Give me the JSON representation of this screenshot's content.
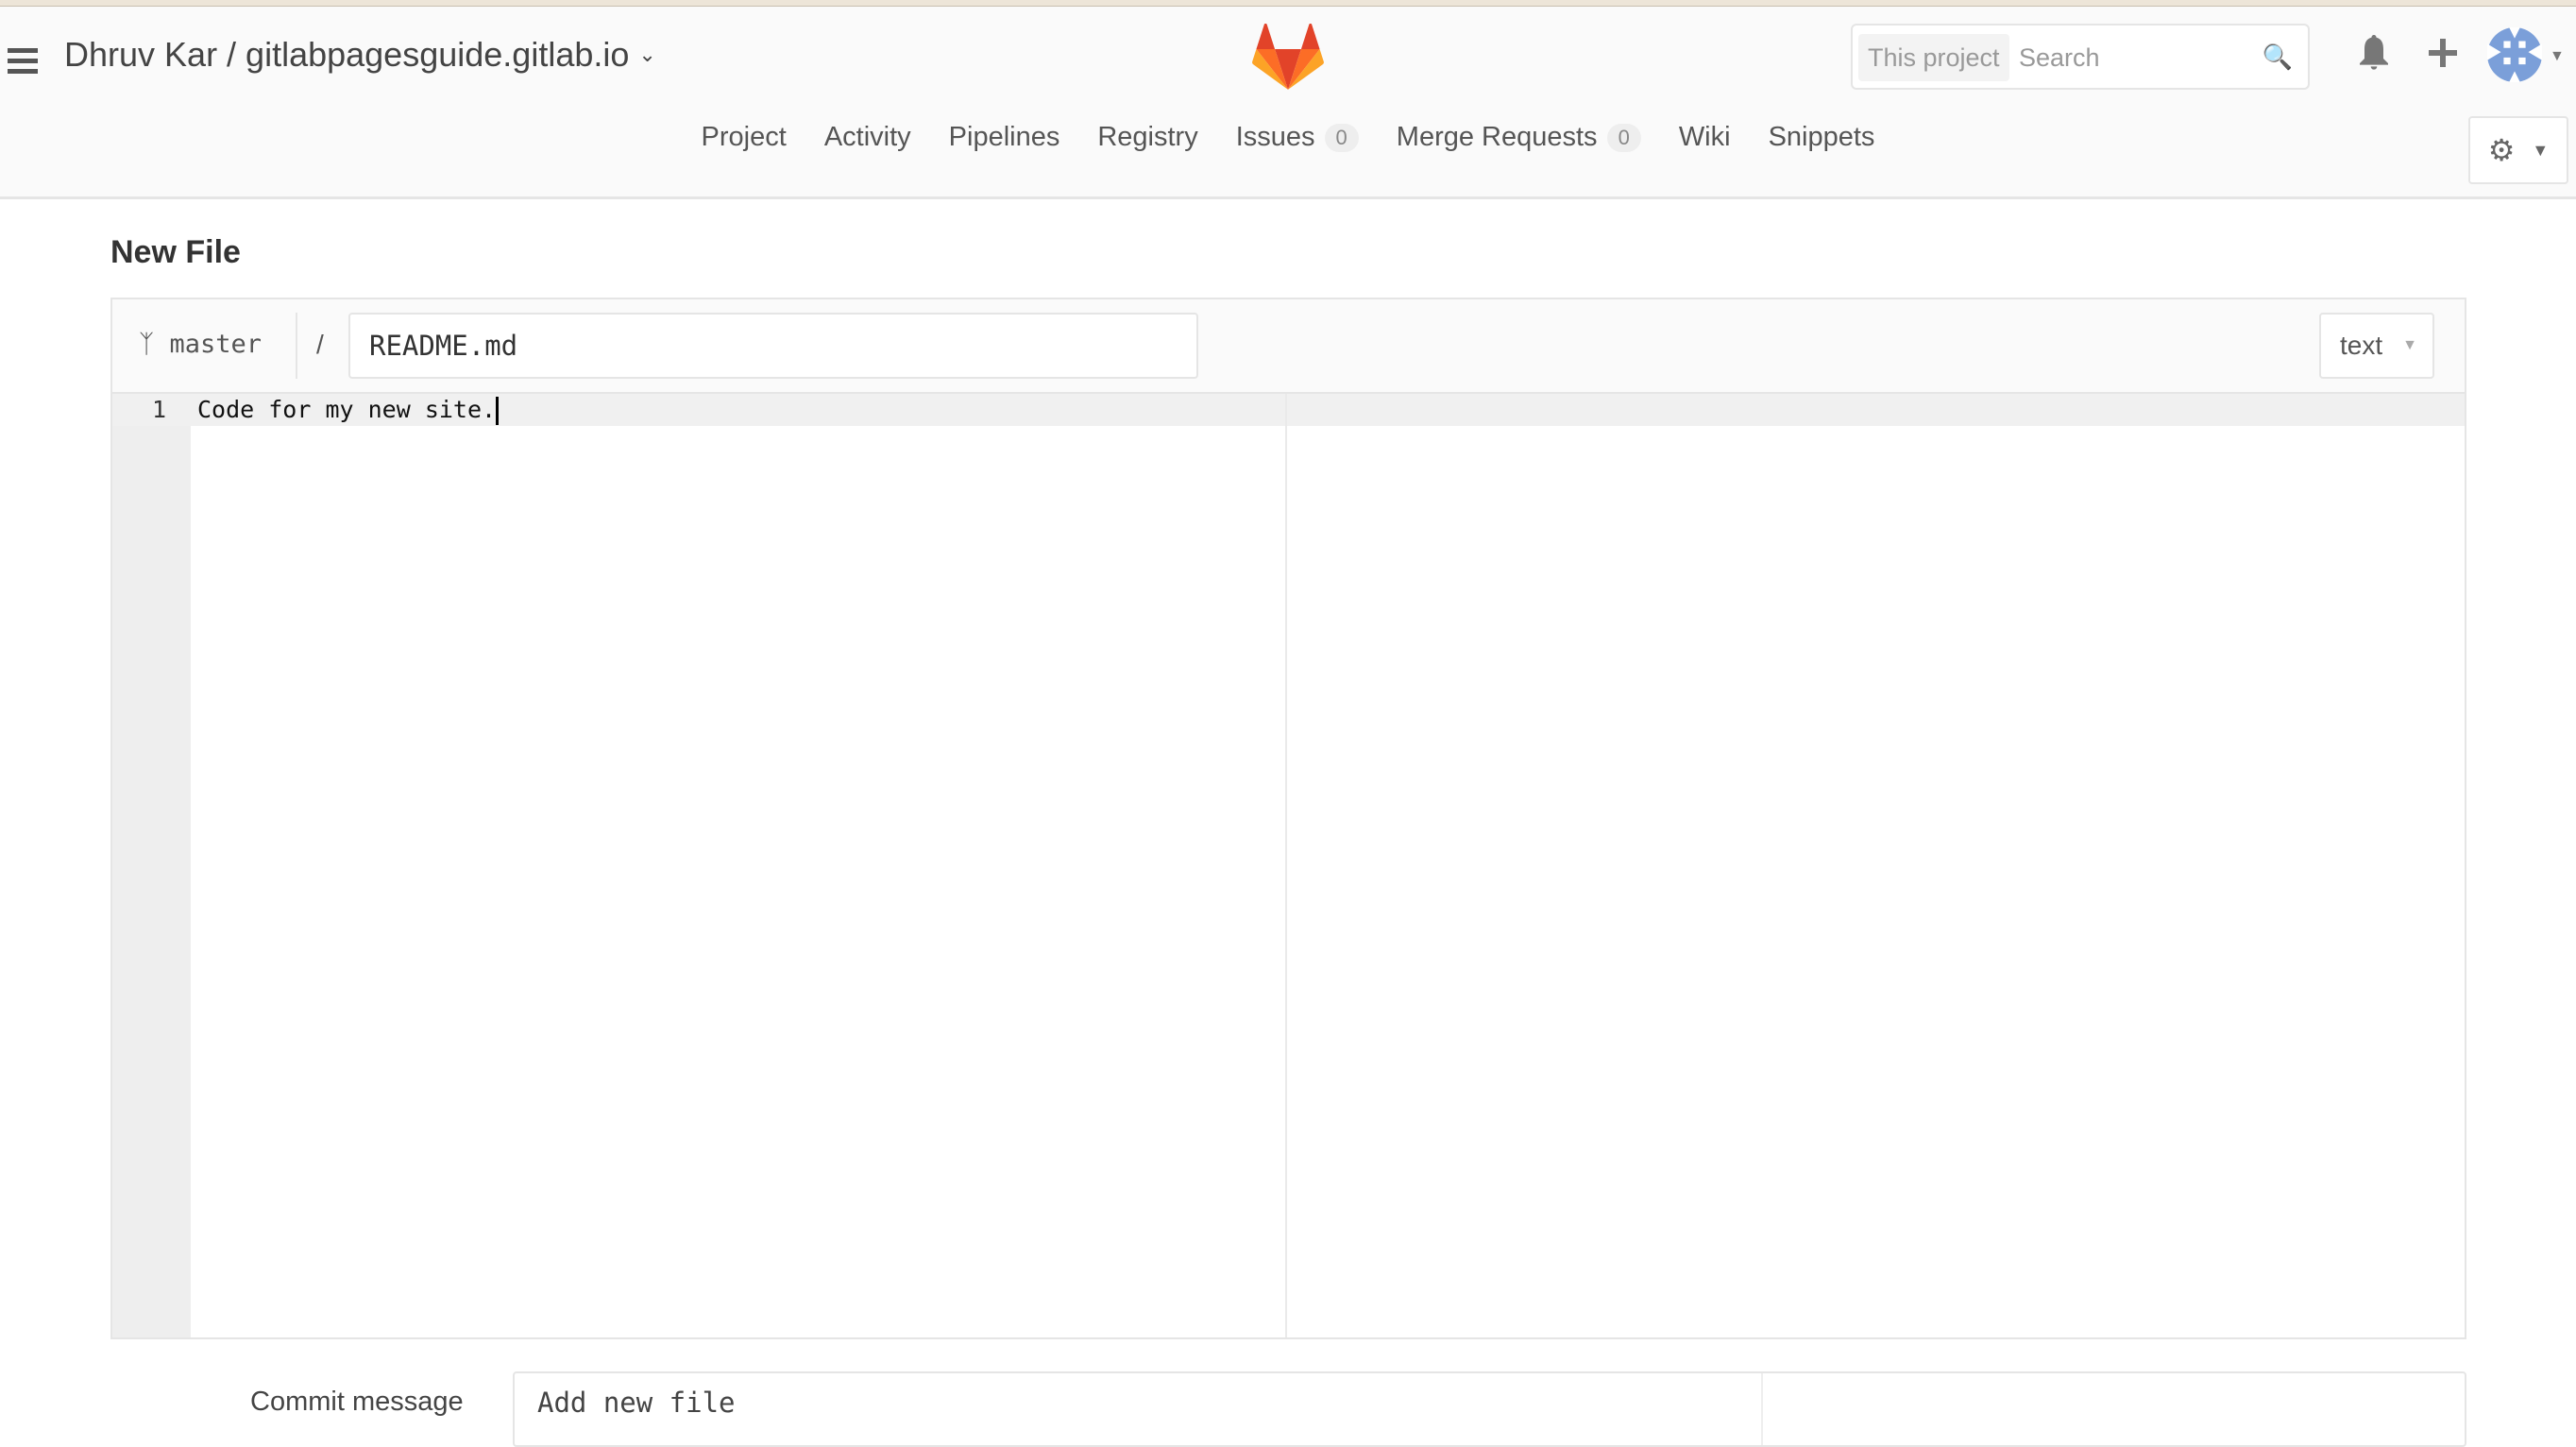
{
  "header": {
    "project_path": "Dhruv Kar / gitlabpagesguide.gitlab.io",
    "search_scope": "This project",
    "search_placeholder": "Search"
  },
  "nav": {
    "items": [
      {
        "label": "Project"
      },
      {
        "label": "Activity"
      },
      {
        "label": "Pipelines"
      },
      {
        "label": "Registry"
      },
      {
        "label": "Issues",
        "count": "0"
      },
      {
        "label": "Merge Requests",
        "count": "0"
      },
      {
        "label": "Wiki"
      },
      {
        "label": "Snippets"
      }
    ]
  },
  "page": {
    "title": "New File"
  },
  "editor": {
    "branch": "master",
    "path_separator": "/",
    "file_name": "README.md",
    "mode": "text",
    "lines": [
      {
        "number": "1",
        "text": "Code for my new site."
      }
    ]
  },
  "commit": {
    "label": "Commit message",
    "value": "Add new file"
  },
  "colors": {
    "logo_orange": "#fc6d26",
    "logo_red": "#e24329",
    "avatar_blue": "#7b9fd9"
  }
}
